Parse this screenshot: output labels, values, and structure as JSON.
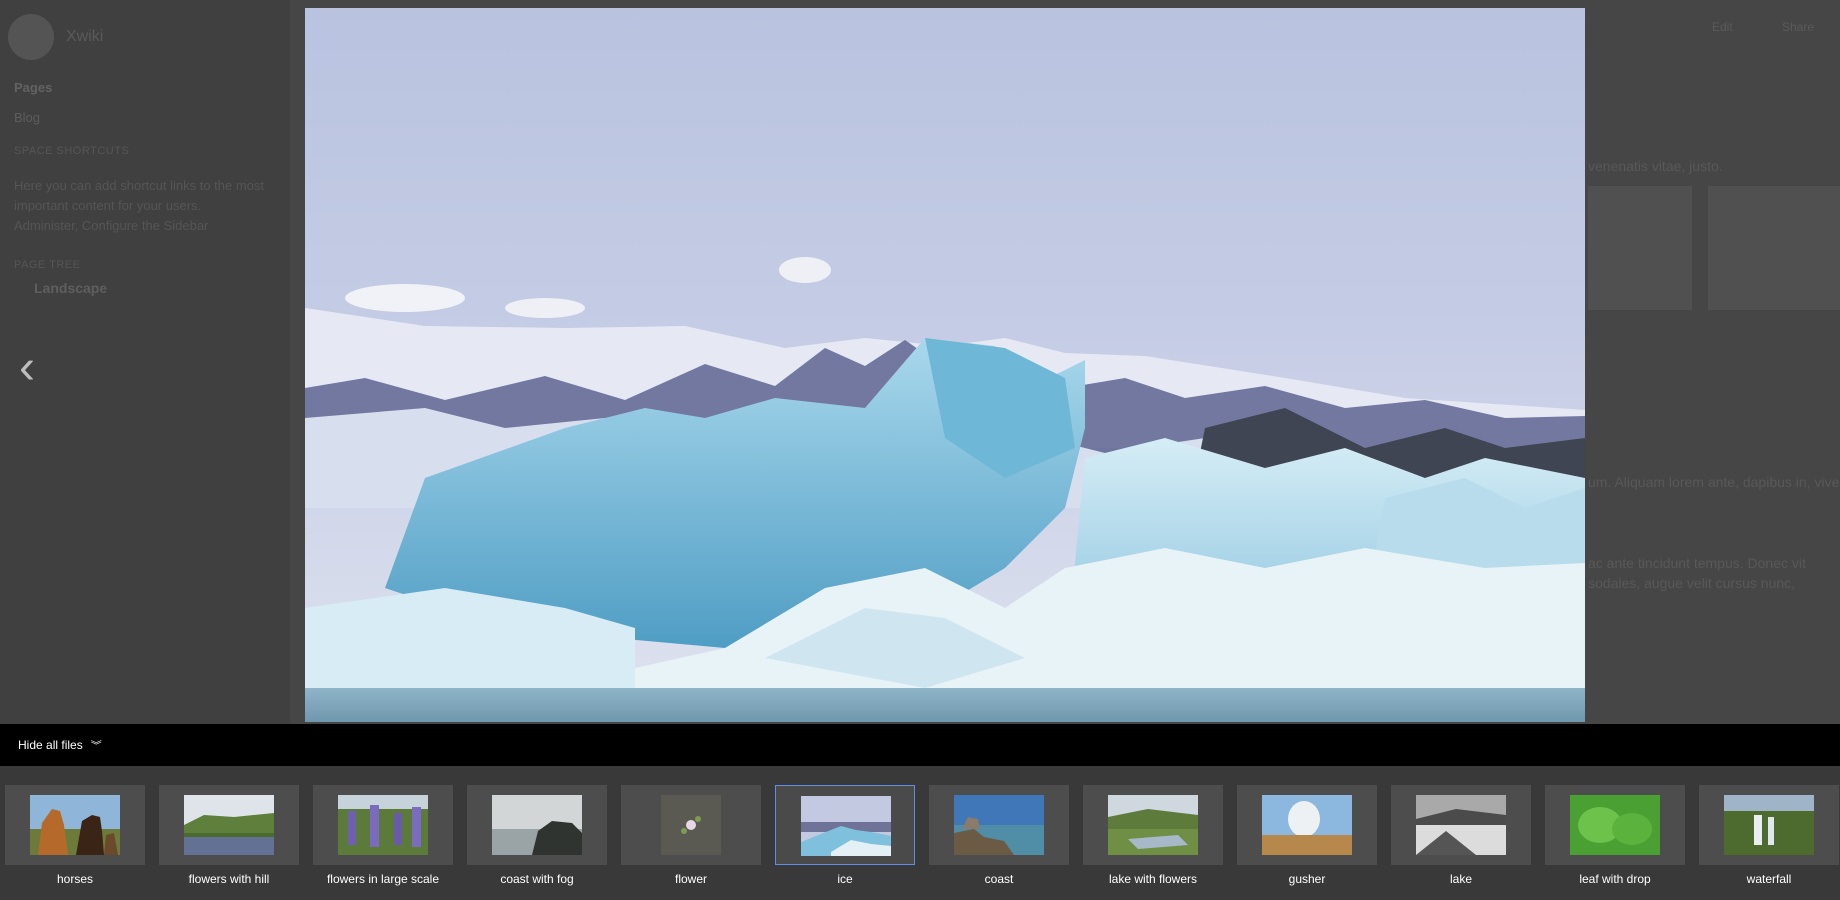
{
  "background_page": {
    "brand": "Xwiki",
    "nav": [
      "Pages",
      "Blog"
    ],
    "section_shortcuts": "SPACE SHORTCUTS",
    "shortcuts_text": "Here you can add shortcut links to the most important content for your users. Administer, Configure the Sidebar",
    "section_tree": "PAGE TREE",
    "tree_item": "Landscape",
    "header_actions": [
      "Edit",
      "Share"
    ],
    "right_snippets": [
      "venenatis vitae, justo.",
      "um. Aliquam lorem ante, dapibus in, vive",
      "ac ante tincidunt tempus. Donec vit",
      "sodales, augue velit cursus nunc,"
    ]
  },
  "viewer": {
    "current_image": "ice",
    "prev_icon": "chevron-left-icon",
    "toggle_label": "Hide all files",
    "toggle_icon": "double-chevron-down-icon",
    "selected_index": 5,
    "accent": "#5e8ee6"
  },
  "thumbnails": [
    {
      "label": "horses"
    },
    {
      "label": "flowers with hill"
    },
    {
      "label": "flowers in large scale"
    },
    {
      "label": "coast with fog"
    },
    {
      "label": "flower"
    },
    {
      "label": "ice"
    },
    {
      "label": "coast"
    },
    {
      "label": "lake with flowers"
    },
    {
      "label": "gusher"
    },
    {
      "label": "lake"
    },
    {
      "label": "leaf with drop"
    },
    {
      "label": "waterfall"
    }
  ]
}
